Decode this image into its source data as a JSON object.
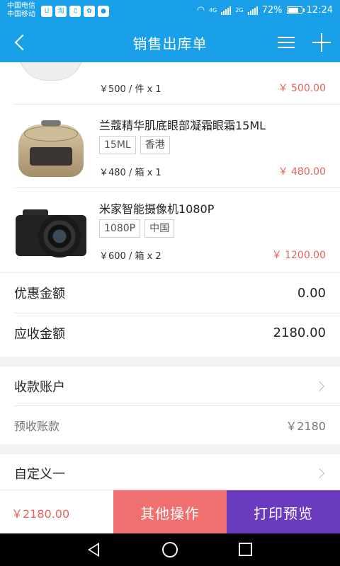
{
  "status_bar": {
    "carrier1": "中国电信",
    "carrier2": "中国移动",
    "net1": "4G",
    "net2": "2G",
    "battery": "72%",
    "time": "12:24"
  },
  "navbar": {
    "title": "销售出库单"
  },
  "products": [
    {
      "name": "",
      "tags": [],
      "info": "￥500 / 件 x 1",
      "price": "￥ 500.00",
      "icon": "pistachio-bowl-image"
    },
    {
      "name": "兰蔻精华肌底眼部凝霜眼霜15ML",
      "tags": [
        "15ML",
        "香港"
      ],
      "info": "￥480 / 箱 x 1",
      "price": "￥ 480.00",
      "icon": "rice-cooker-image"
    },
    {
      "name": "米家智能摄像机1080P",
      "tags": [
        "1080P",
        "中国"
      ],
      "info": "￥600 / 箱 x 2",
      "price": "￥ 1200.00",
      "icon": "camera-image"
    }
  ],
  "summary": {
    "discount_label": "优惠金额",
    "discount_value": "0.00",
    "receivable_label": "应收金额",
    "receivable_value": "2180.00"
  },
  "account": {
    "label": "收款账户",
    "prepaid_label": "预收账款",
    "prepaid_value": "￥2180"
  },
  "custom": {
    "label": "自定义一"
  },
  "action_bar": {
    "total": "￥2180.00",
    "other_label": "其他操作",
    "print_label": "打印预览"
  },
  "colors": {
    "primary": "#1aa0e8",
    "price_red": "#e8605a",
    "other_button": "#f07070",
    "print_button": "#6a3bbf"
  }
}
